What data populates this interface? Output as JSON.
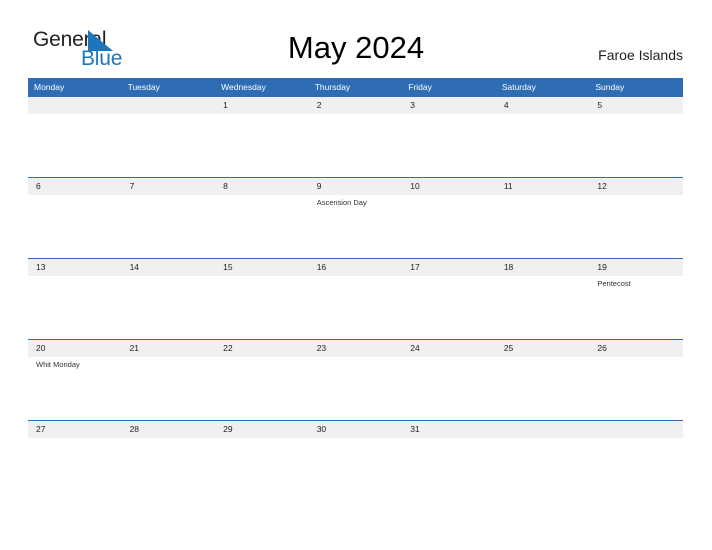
{
  "brand": {
    "name_part1": "General",
    "name_part2": "Blue",
    "triangle_color": "#1d76bc"
  },
  "header": {
    "title": "May 2024",
    "region": "Faroe Islands"
  },
  "theme": {
    "header_blue": "#2e6db4",
    "daynum_band": "#f0f0f0",
    "page_background": "#ffffff",
    "text_color": "#222222"
  },
  "calendar": {
    "weekdays": [
      "Monday",
      "Tuesday",
      "Wednesday",
      "Thursday",
      "Friday",
      "Saturday",
      "Sunday"
    ],
    "weeks": [
      {
        "days": [
          {
            "number": "",
            "event": ""
          },
          {
            "number": "",
            "event": ""
          },
          {
            "number": "1",
            "event": ""
          },
          {
            "number": "2",
            "event": ""
          },
          {
            "number": "3",
            "event": ""
          },
          {
            "number": "4",
            "event": ""
          },
          {
            "number": "5",
            "event": ""
          }
        ]
      },
      {
        "days": [
          {
            "number": "6",
            "event": ""
          },
          {
            "number": "7",
            "event": ""
          },
          {
            "number": "8",
            "event": ""
          },
          {
            "number": "9",
            "event": "Ascension Day"
          },
          {
            "number": "10",
            "event": ""
          },
          {
            "number": "11",
            "event": ""
          },
          {
            "number": "12",
            "event": ""
          }
        ]
      },
      {
        "days": [
          {
            "number": "13",
            "event": ""
          },
          {
            "number": "14",
            "event": ""
          },
          {
            "number": "15",
            "event": ""
          },
          {
            "number": "16",
            "event": ""
          },
          {
            "number": "17",
            "event": ""
          },
          {
            "number": "18",
            "event": ""
          },
          {
            "number": "19",
            "event": "Pentecost"
          }
        ]
      },
      {
        "days": [
          {
            "number": "20",
            "event": "Whit Monday"
          },
          {
            "number": "21",
            "event": ""
          },
          {
            "number": "22",
            "event": ""
          },
          {
            "number": "23",
            "event": ""
          },
          {
            "number": "24",
            "event": ""
          },
          {
            "number": "25",
            "event": ""
          },
          {
            "number": "26",
            "event": ""
          }
        ]
      },
      {
        "days": [
          {
            "number": "27",
            "event": ""
          },
          {
            "number": "28",
            "event": ""
          },
          {
            "number": "29",
            "event": ""
          },
          {
            "number": "30",
            "event": ""
          },
          {
            "number": "31",
            "event": ""
          },
          {
            "number": "",
            "event": ""
          },
          {
            "number": "",
            "event": ""
          }
        ]
      }
    ]
  }
}
